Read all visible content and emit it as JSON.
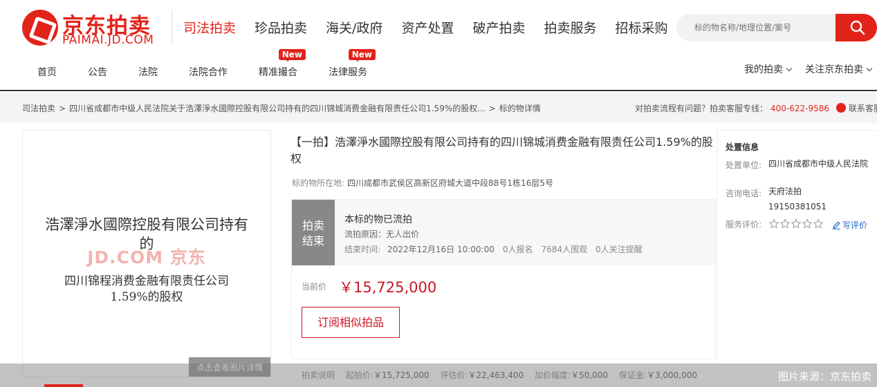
{
  "logo": {
    "cn": "京东拍卖",
    "en": "PAIMAI.JD.COM"
  },
  "main_nav": [
    "司法拍卖",
    "珍品拍卖",
    "海关/政府",
    "资产处置",
    "破产拍卖",
    "拍卖服务",
    "招标采购"
  ],
  "search": {
    "placeholder": "标的物名称/地理位置/案号"
  },
  "sub_nav": [
    {
      "label": "首页"
    },
    {
      "label": "公告"
    },
    {
      "label": "法院"
    },
    {
      "label": "法院合作"
    },
    {
      "label": "精准撮合",
      "badge": "New"
    },
    {
      "label": "法律服务",
      "badge": "New"
    }
  ],
  "right_links": {
    "my_auction": "我的拍卖",
    "follow": "关注京东拍卖"
  },
  "breadcrumb": {
    "c1": "司法拍卖",
    "c2": "四川省成都市中级人民法院关于浩澤淨水國際控股有限公司持有的四川锦城消费金融有限责任公司1.59%的股权...",
    "c3": "标的物详情",
    "sep": ">"
  },
  "help": {
    "question": "对拍卖流程有问题？拍卖客服专线：",
    "phone": "400-622-9586",
    "service": "联系客服"
  },
  "image": {
    "line1": "浩澤淨水國際控股有限公司持有的",
    "watermark": "JD.COM 京东",
    "line2": "四川锦程消费金融有限责任公司1.59%的股权",
    "view_button": "点击查看图片详情"
  },
  "item": {
    "title": "【一拍】浩澤淨水國際控股有限公司持有的四川锦城消费金融有限责任公司1.59%的股权",
    "location_label": "标的物所在地:",
    "location": "四川成都市武侯区高新区府城大道中段88号1栋16层5号"
  },
  "status": {
    "tag": "拍卖结束",
    "main": "本标的物已流拍",
    "reason": "流拍原因：无人出价",
    "end_label": "结束时间:",
    "end_time": "2022年12月16日 10:00:00",
    "signups": "0人报名",
    "watchers": "7684人围观",
    "reminders": "0人关注提醒"
  },
  "price": {
    "label": "当前价",
    "value": "￥15,725,000"
  },
  "subscribe_label": "订阅相似拍品",
  "rules": {
    "title": "拍卖说明",
    "start_label": "起拍价:",
    "start": "￥15,725,000",
    "assess_label": "评估价:",
    "assess": "￥22,463,400",
    "step_label": "加价幅度:",
    "step": "￥50,000",
    "deposit_label": "保证金:",
    "deposit": "￥3,000,000"
  },
  "panel": {
    "title": "处置信息",
    "unit_label": "处置单位:",
    "unit": "四川省成都市中级人民法院",
    "phone_label": "咨询电话:",
    "phone_name": "天府法拍",
    "phone_number": "19150381051",
    "rating_label": "服务评价:",
    "rating": 0,
    "write_review": "写评价"
  },
  "source": "图片来源：京东拍卖",
  "colors": {
    "brand_red": "#e2231a",
    "price_red": "#c81623",
    "link_blue": "#1a66c8"
  }
}
